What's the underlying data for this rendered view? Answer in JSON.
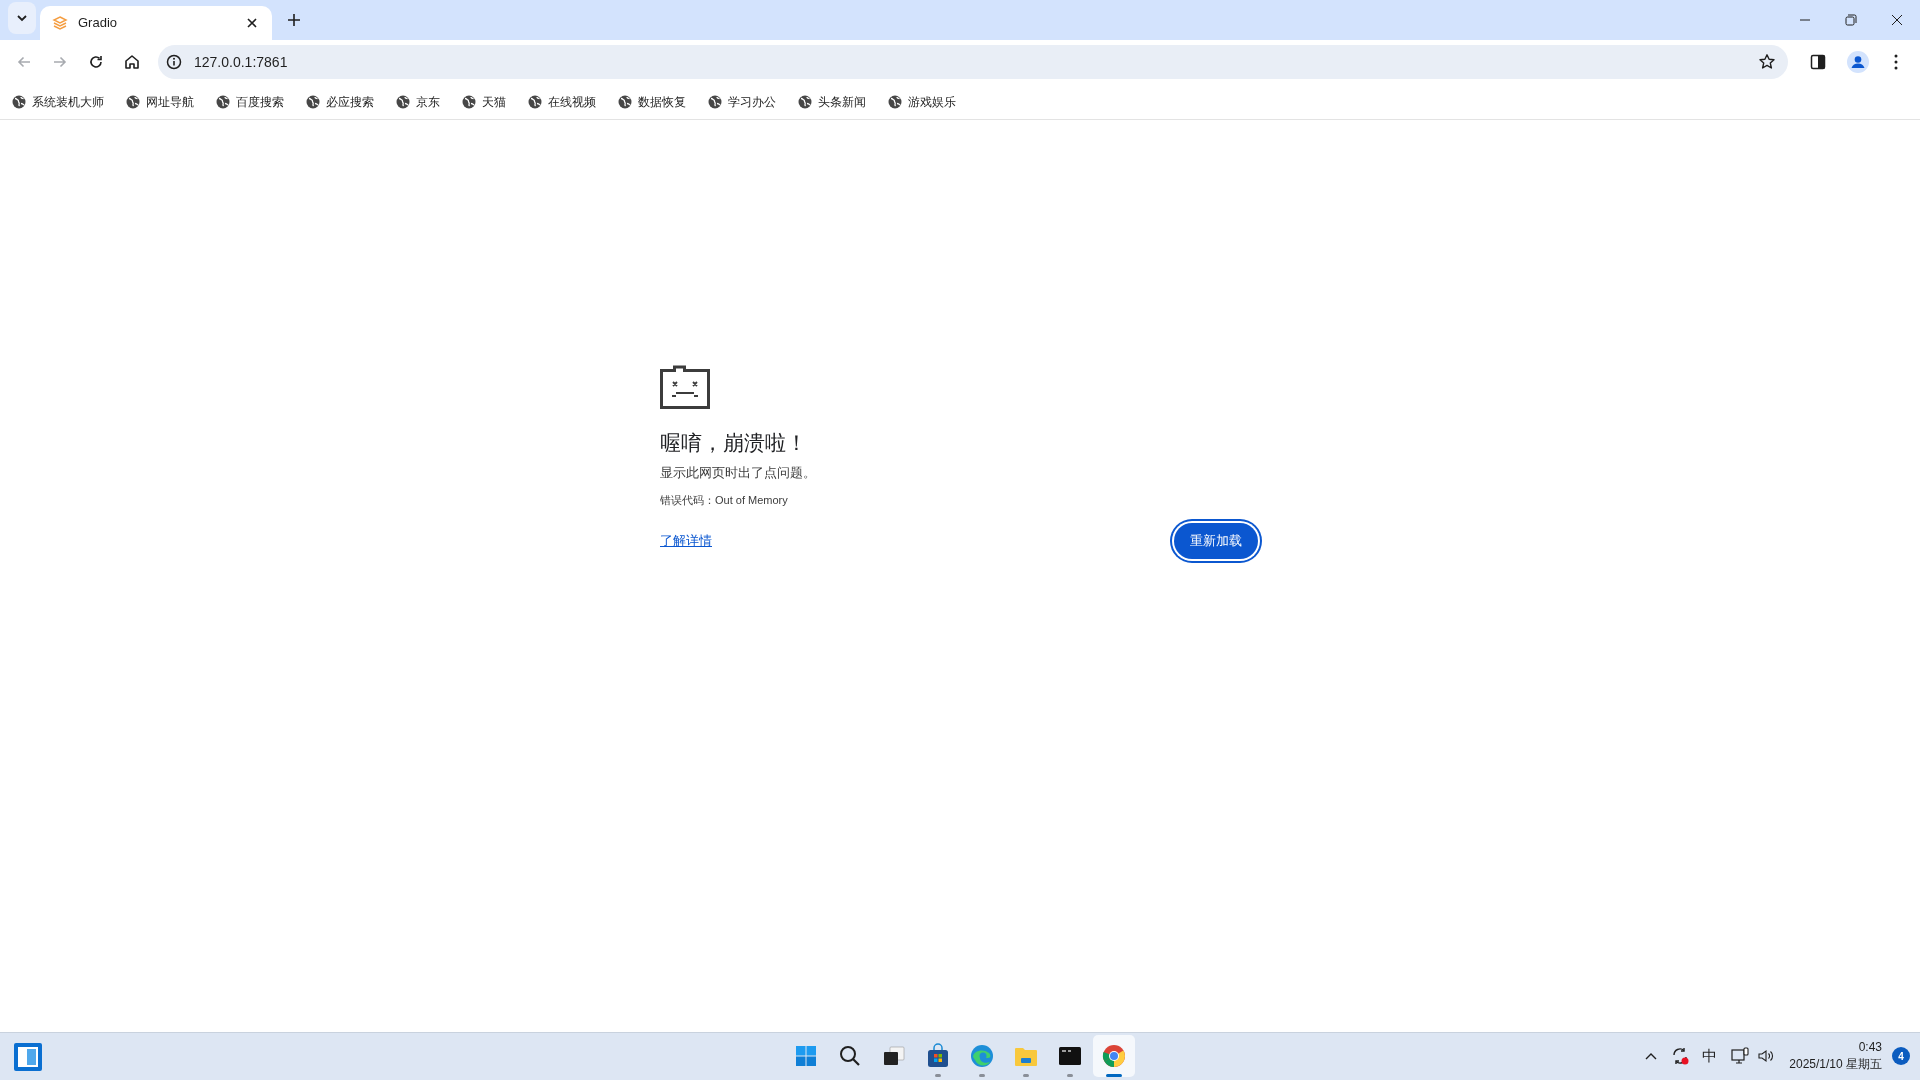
{
  "tabs": [
    {
      "title": "Gradio",
      "selected": true
    }
  ],
  "toolbar": [
    {
      "kind": "back",
      "disabled": true
    },
    {
      "kind": "forward",
      "disabled": true
    },
    {
      "kind": "reload",
      "disabled": false
    },
    {
      "kind": "home",
      "disabled": false
    }
  ],
  "address_bar": {
    "value": "127.0.0.1:7861"
  },
  "bookmarks": [
    "系统装机大师",
    "网址导航",
    "百度搜索",
    "必应搜索",
    "京东",
    "天猫",
    "在线视频",
    "数据恢复",
    "学习办公",
    "头条新闻",
    "游戏娱乐"
  ],
  "error_page": {
    "title": "喔唷，崩溃啦！",
    "message": "显示此网页时出了点问题。",
    "error_code": "错误代码：Out of Memory",
    "link": "了解详情",
    "button": "重新加载"
  },
  "taskbar": {
    "apps": [
      {
        "kind": "start",
        "running": false,
        "selected": false
      },
      {
        "kind": "search",
        "running": false,
        "selected": false
      },
      {
        "kind": "taskview",
        "running": false,
        "selected": false
      },
      {
        "kind": "store",
        "running": true,
        "selected": false
      },
      {
        "kind": "edge",
        "running": true,
        "selected": false
      },
      {
        "kind": "explorer",
        "running": true,
        "selected": false
      },
      {
        "kind": "terminal",
        "running": true,
        "selected": false
      },
      {
        "kind": "chrome",
        "running": true,
        "selected": true
      }
    ],
    "input_method": "中",
    "time": "0:43",
    "date": "2025/1/10 星期五",
    "notifications": "4"
  }
}
